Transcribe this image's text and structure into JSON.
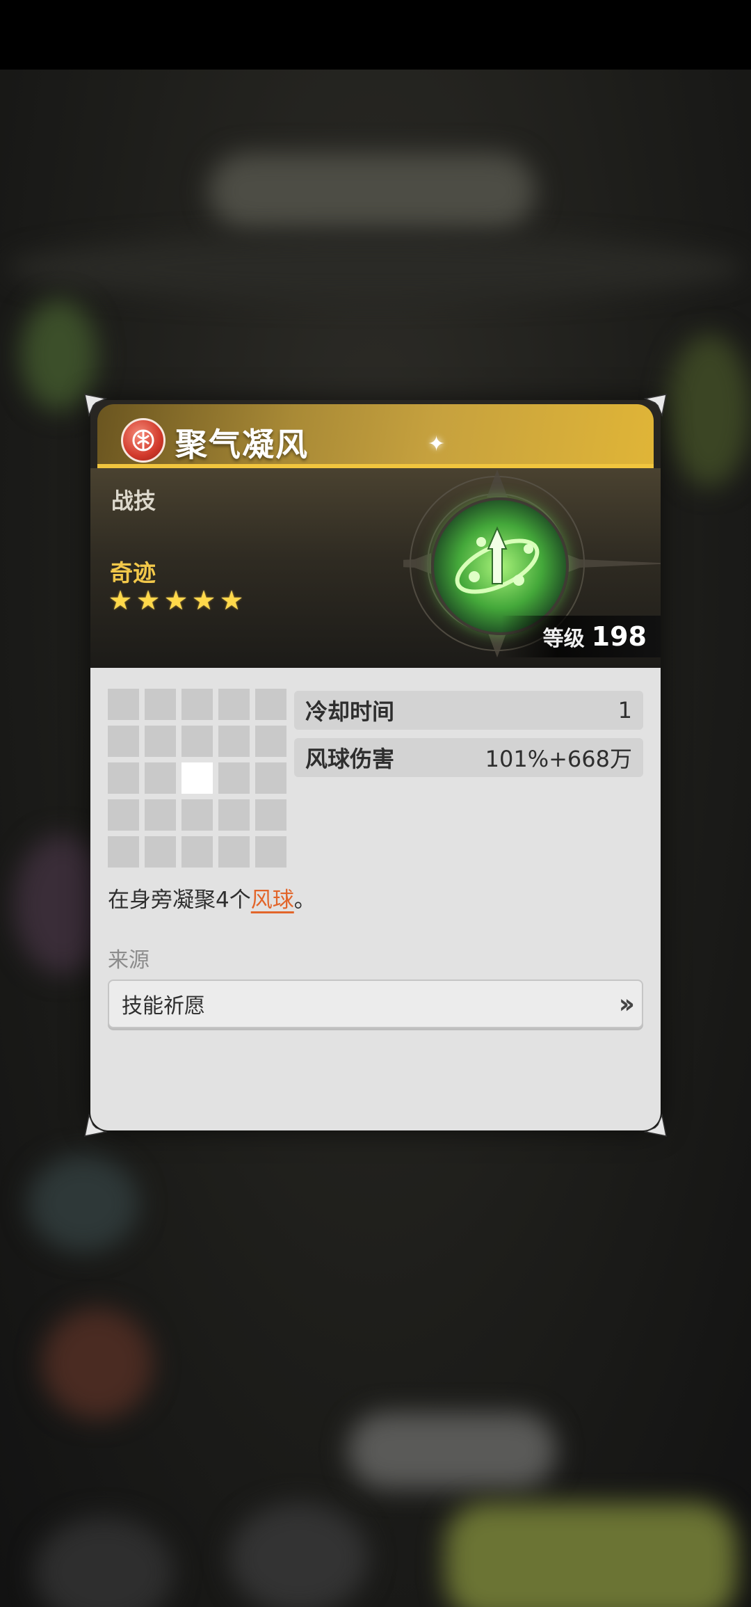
{
  "skill": {
    "name": "聚气凝风",
    "type": "战技",
    "rarity_label": "奇迹",
    "stars": 5,
    "level_label": "等级",
    "level_value": "198",
    "element_icon": "wind-element-icon",
    "skill_icon": "wind-orb-skill-icon"
  },
  "range_grid": {
    "rows": 5,
    "cols": 5,
    "active_cell": [
      2,
      2
    ]
  },
  "stats": [
    {
      "name": "冷却时间",
      "value": "1"
    },
    {
      "name": "风球伤害",
      "value": "101%+668万"
    }
  ],
  "description": {
    "prefix": "在身旁凝聚4个",
    "keyword": "风球",
    "suffix": "。"
  },
  "source": {
    "label": "来源",
    "button_label": "技能祈愿",
    "button_icon": "double-chevron-right-icon"
  },
  "colors": {
    "title_gold": "#e0b537",
    "rarity": "#f2c84a",
    "keyword": "#e2652a",
    "panel": "#e2e2e2"
  }
}
